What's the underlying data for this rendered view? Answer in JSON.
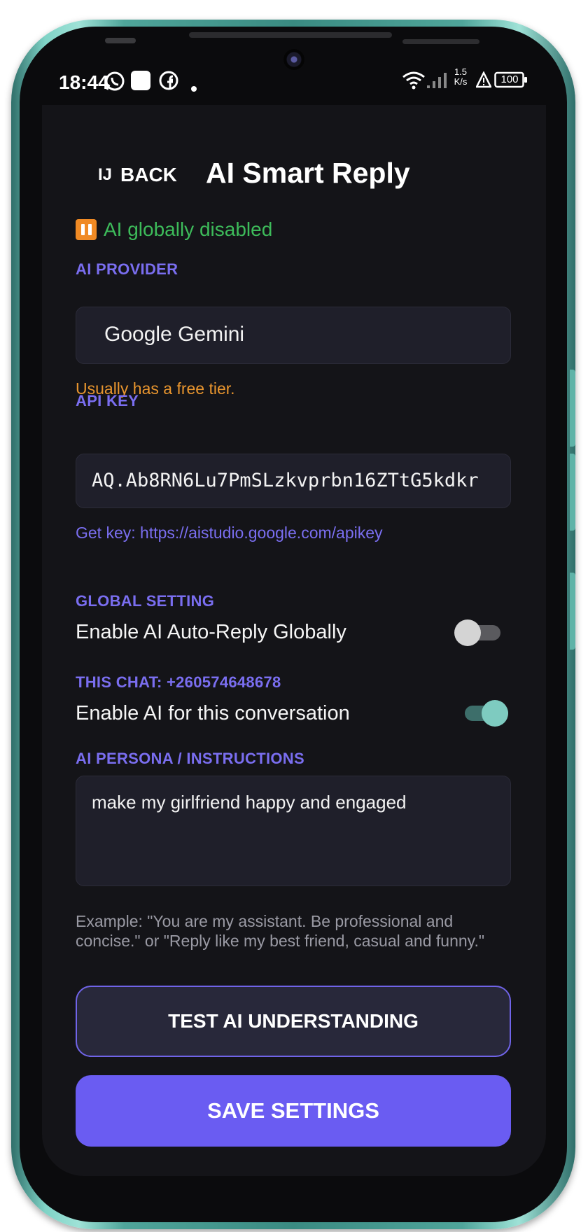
{
  "status_bar": {
    "time": "18:44",
    "net_speed_value": "1.5",
    "net_speed_unit": "K/s",
    "battery": "100",
    "icons": [
      "whatsapp-icon",
      "app-square-icon",
      "facebook-icon",
      "dot-icon",
      "wifi-icon",
      "signal-icon",
      "alert-icon",
      "battery-icon"
    ]
  },
  "header": {
    "back_icon": "IJ",
    "back_label": "BACK",
    "title": "AI Smart Reply"
  },
  "ai_status": {
    "icon": "pause-icon",
    "text": "AI globally disabled"
  },
  "provider": {
    "label": "AI PROVIDER",
    "value": "Google Gemini",
    "hint": "Usually has a free tier."
  },
  "api_key": {
    "label": "API KEY",
    "value": "AQ.Ab8RN6Lu7PmSLzkvprbn16ZTtG5kdkr",
    "link": "Get key: https://aistudio.google.com/apikey"
  },
  "global_setting": {
    "label": "GLOBAL SETTING",
    "text": "Enable AI Auto-Reply Globally",
    "enabled": false
  },
  "this_chat": {
    "label": "THIS CHAT: +260574648678",
    "text": "Enable AI for this conversation",
    "enabled": true
  },
  "persona": {
    "label": "AI PERSONA / INSTRUCTIONS",
    "value": "make my girlfriend happy and engaged",
    "example": "Example: \"You are my assistant. Be professional and concise.\" or \"Reply like my best friend, casual and funny.\""
  },
  "buttons": {
    "test": "TEST AI UNDERSTANDING",
    "save": "SAVE SETTINGS"
  },
  "colors": {
    "accent": "#6a5cf2",
    "label": "#7a6ef0",
    "enabled_green": "#3dbb5a",
    "hint_orange": "#e8952e",
    "toggle_on": "#7ecbc0",
    "background": "#141418"
  }
}
